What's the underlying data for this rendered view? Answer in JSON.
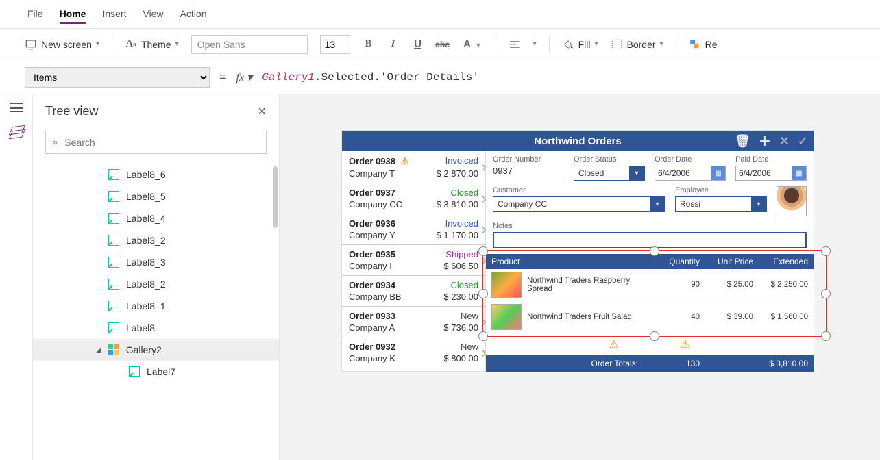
{
  "menu": {
    "tabs": [
      "File",
      "Home",
      "Insert",
      "View",
      "Action"
    ],
    "active": "Home"
  },
  "ribbon": {
    "new_screen": "New screen",
    "theme": "Theme",
    "font_name": "Open Sans",
    "font_size": "13",
    "fill": "Fill",
    "border": "Border",
    "reorder": "Re"
  },
  "formula": {
    "property": "Items",
    "fx": "fx",
    "ident": "Gallery1",
    "rest": ".Selected.'Order Details'"
  },
  "tree": {
    "title": "Tree view",
    "search_placeholder": "Search",
    "items": [
      {
        "label": "Label8_6",
        "type": "label"
      },
      {
        "label": "Label8_5",
        "type": "label"
      },
      {
        "label": "Label8_4",
        "type": "label"
      },
      {
        "label": "Label3_2",
        "type": "label"
      },
      {
        "label": "Label8_3",
        "type": "label"
      },
      {
        "label": "Label8_2",
        "type": "label"
      },
      {
        "label": "Label8_1",
        "type": "label"
      },
      {
        "label": "Label8",
        "type": "label"
      },
      {
        "label": "Gallery2",
        "type": "gallery",
        "selected": true
      },
      {
        "label": "Label7",
        "type": "label",
        "indent": true
      }
    ]
  },
  "app": {
    "title": "Northwind Orders",
    "orders": [
      {
        "id": "Order 0938",
        "company": "Company T",
        "status": "Invoiced",
        "amount": "$ 2,870.00",
        "warn": true
      },
      {
        "id": "Order 0937",
        "company": "Company CC",
        "status": "Closed",
        "amount": "$ 3,810.00"
      },
      {
        "id": "Order 0936",
        "company": "Company Y",
        "status": "Invoiced",
        "amount": "$ 1,170.00"
      },
      {
        "id": "Order 0935",
        "company": "Company I",
        "status": "Shipped",
        "amount": "$ 606.50"
      },
      {
        "id": "Order 0934",
        "company": "Company BB",
        "status": "Closed",
        "amount": "$ 230.00"
      },
      {
        "id": "Order 0933",
        "company": "Company A",
        "status": "New",
        "amount": "$ 736.00"
      },
      {
        "id": "Order 0932",
        "company": "Company K",
        "status": "New",
        "amount": "$ 800.00"
      }
    ],
    "detail": {
      "labels": {
        "order_number": "Order Number",
        "order_status": "Order Status",
        "order_date": "Order Date",
        "paid_date": "Paid Date",
        "customer": "Customer",
        "employee": "Employee",
        "notes": "Notes"
      },
      "order_number": "0937",
      "order_status": "Closed",
      "order_date": "6/4/2006",
      "paid_date": "6/4/2006",
      "customer": "Company CC",
      "employee": "Rossi"
    },
    "grid": {
      "headers": {
        "product": "Product",
        "qty": "Quantity",
        "price": "Unit Price",
        "ext": "Extended"
      },
      "lines": [
        {
          "name": "Northwind Traders Raspberry Spread",
          "qty": "90",
          "price": "$ 25.00",
          "ext": "$ 2,250.00"
        },
        {
          "name": "Northwind Traders Fruit Salad",
          "qty": "40",
          "price": "$ 39.00",
          "ext": "$ 1,560.00"
        }
      ],
      "totals": {
        "label": "Order Totals:",
        "qty": "130",
        "amount": "$ 3,810.00"
      }
    }
  }
}
